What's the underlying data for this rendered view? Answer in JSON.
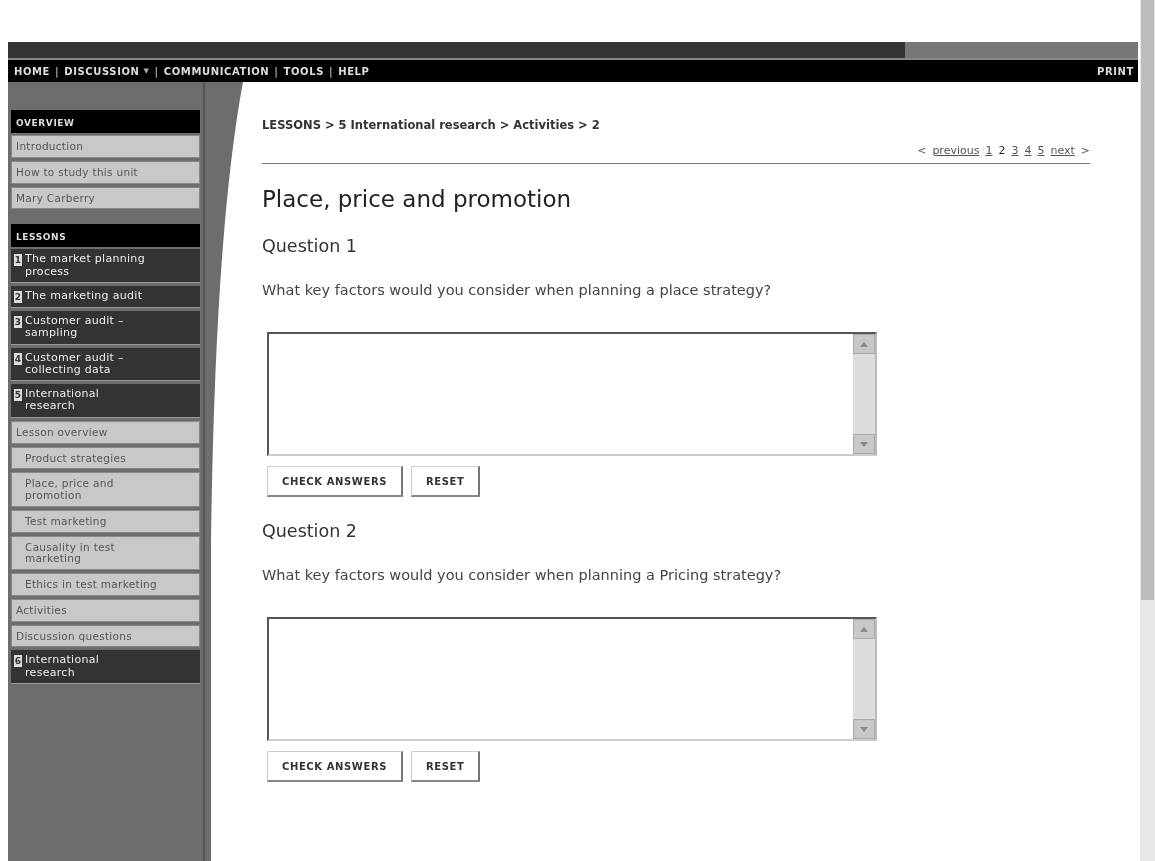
{
  "nav": {
    "items": [
      {
        "label": "HOME",
        "dropdown": false
      },
      {
        "label": "DISCUSSION",
        "dropdown": true
      },
      {
        "label": "COMMUNICATION",
        "dropdown": false
      },
      {
        "label": "TOOLS",
        "dropdown": false
      },
      {
        "label": "HELP",
        "dropdown": false
      }
    ],
    "separator": "|",
    "dropdown_glyph": "▼",
    "print": "PRINT"
  },
  "sidebar": {
    "sections": [
      {
        "title": "OVERVIEW",
        "items": [
          {
            "label": "Introduction"
          },
          {
            "label": "How to study this unit"
          },
          {
            "label": "Mary Carberry"
          }
        ]
      },
      {
        "title": "LESSONS",
        "items": [
          {
            "number": "1",
            "label": "The market planning process"
          },
          {
            "number": "2",
            "label": "The marketing audit"
          },
          {
            "number": "3",
            "label": "Customer audit – sampling"
          },
          {
            "number": "4",
            "label": "Customer audit – collecting data"
          },
          {
            "number": "5",
            "label": "International research",
            "children": [
              {
                "label": "Lesson overview",
                "children": [
                  {
                    "label": "Product strategies"
                  },
                  {
                    "label": "Place, price and promotion"
                  },
                  {
                    "label": "Test marketing"
                  },
                  {
                    "label": "Causality in test marketing"
                  },
                  {
                    "label": "Ethics in test marketing"
                  }
                ]
              },
              {
                "label": "Activities"
              },
              {
                "label": "Discussion questions"
              }
            ]
          },
          {
            "number": "6",
            "label": "International research"
          }
        ]
      }
    ]
  },
  "main": {
    "breadcrumb": "LESSONS > 5 International research > Activities > 2",
    "pager": {
      "prev_arrow": "<",
      "prev": "previous",
      "pages": [
        {
          "label": "1",
          "selected": false
        },
        {
          "label": "2",
          "selected": true
        },
        {
          "label": "3",
          "selected": false
        },
        {
          "label": "4",
          "selected": false
        },
        {
          "label": "5",
          "selected": false
        }
      ],
      "next": "next",
      "next_arrow": ">"
    },
    "title": "Place, price and promotion",
    "questions": [
      {
        "title": "Question 1",
        "prompt": "What key factors would you consider when planning a place strategy?",
        "buttons": [
          "CHECK ANSWERS",
          "RESET"
        ]
      },
      {
        "title": "Question 2",
        "prompt": "What key factors would you consider when planning a Pricing strategy?",
        "buttons": [
          "CHECK ANSWERS",
          "RESET"
        ]
      }
    ]
  }
}
